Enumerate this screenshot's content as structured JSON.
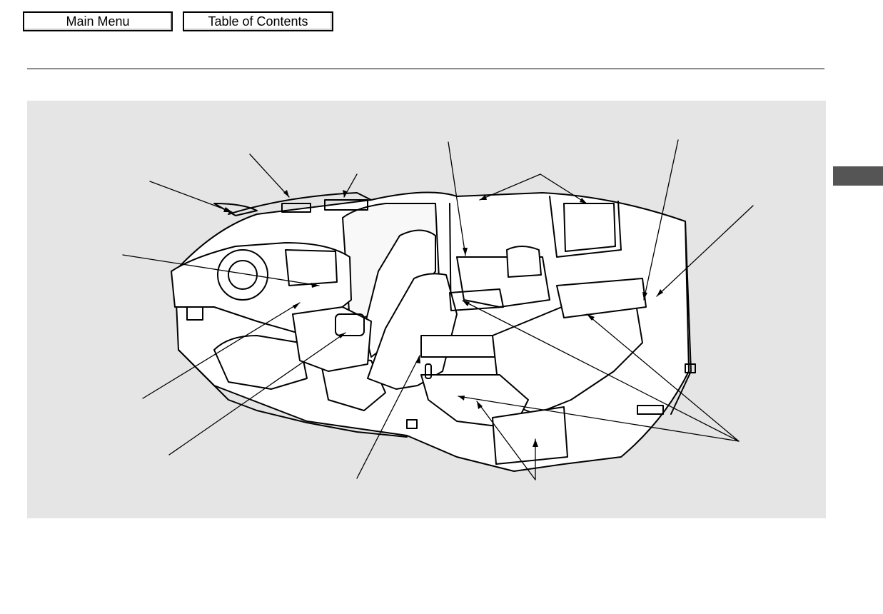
{
  "nav": {
    "main_menu": "Main Menu",
    "table_of_contents": "Table of Contents"
  },
  "colors": {
    "panel_background": "#e5e5e5",
    "side_tab": "#555555",
    "line_art": "#000000"
  },
  "figure": {
    "subject": "vehicle-interior-cutaway-illustration"
  }
}
